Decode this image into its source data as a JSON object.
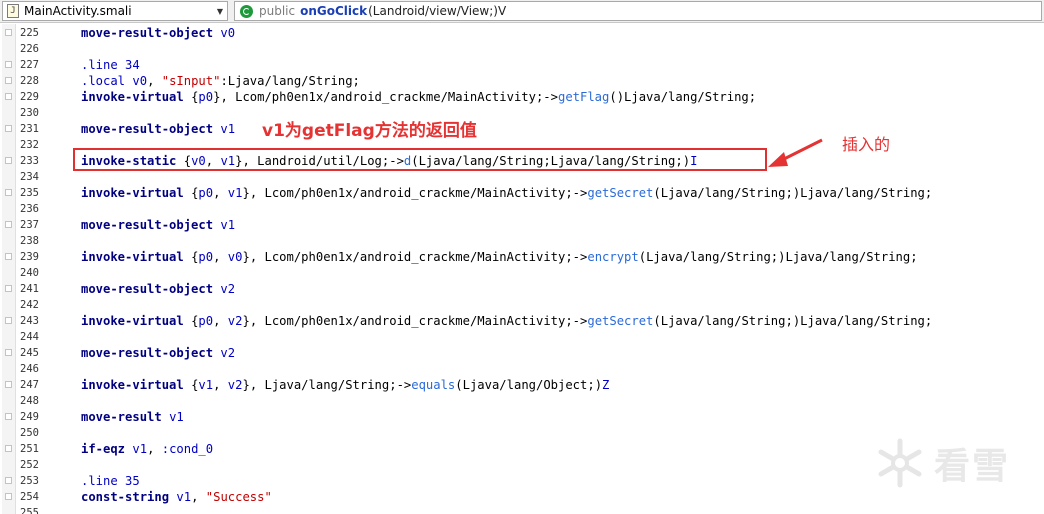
{
  "toolbar": {
    "file_icon_glyph": "J",
    "file_name": "MainActivity.smali",
    "method_modifier": "public",
    "method_name": "onGoClick",
    "method_signature": "(Landroid/view/View;)V"
  },
  "annotations": {
    "v1_note": "v1为getFlag方法的返回值",
    "insert_note": "插入的",
    "accent_color": "#e53333"
  },
  "watermark": {
    "text": "看雪"
  },
  "code_lines": [
    {
      "n": "225",
      "tokens": [
        [
          "k",
          "move-result-object"
        ],
        [
          "t",
          " "
        ],
        [
          "r",
          "v0"
        ]
      ]
    },
    {
      "n": "226",
      "tokens": []
    },
    {
      "n": "227",
      "tokens": [
        [
          "r",
          ".line"
        ],
        [
          "t",
          " "
        ],
        [
          "r",
          "34"
        ]
      ]
    },
    {
      "n": "228",
      "tokens": [
        [
          "r",
          ".local"
        ],
        [
          "t",
          " "
        ],
        [
          "r",
          "v0"
        ],
        [
          "t",
          ", "
        ],
        [
          "s",
          "\"sInput\""
        ],
        [
          "t",
          ":Ljava/lang/String;"
        ]
      ]
    },
    {
      "n": "229",
      "tokens": [
        [
          "k",
          "invoke-virtual"
        ],
        [
          "t",
          " {"
        ],
        [
          "r",
          "p0"
        ],
        [
          "t",
          "}, Lcom/ph0en1x/android_crackme/MainActivity;->"
        ],
        [
          "m",
          "getFlag"
        ],
        [
          "t",
          "()Ljava/lang/String;"
        ]
      ]
    },
    {
      "n": "230",
      "tokens": []
    },
    {
      "n": "231",
      "tokens": [
        [
          "k",
          "move-result-object"
        ],
        [
          "t",
          " "
        ],
        [
          "r",
          "v1"
        ]
      ]
    },
    {
      "n": "232",
      "tokens": []
    },
    {
      "n": "233",
      "tokens": [
        [
          "k",
          "invoke-static"
        ],
        [
          "t",
          " {"
        ],
        [
          "r",
          "v0"
        ],
        [
          "t",
          ", "
        ],
        [
          "r",
          "v1"
        ],
        [
          "t",
          "}, Landroid/util/Log;->"
        ],
        [
          "m",
          "d"
        ],
        [
          "t",
          "(Ljava/lang/String;Ljava/lang/String;)"
        ],
        [
          "r",
          "I"
        ]
      ]
    },
    {
      "n": "234",
      "tokens": []
    },
    {
      "n": "235",
      "tokens": [
        [
          "k",
          "invoke-virtual"
        ],
        [
          "t",
          " {"
        ],
        [
          "r",
          "p0"
        ],
        [
          "t",
          ", "
        ],
        [
          "r",
          "v1"
        ],
        [
          "t",
          "}, Lcom/ph0en1x/android_crackme/MainActivity;->"
        ],
        [
          "m",
          "getSecret"
        ],
        [
          "t",
          "(Ljava/lang/String;)Ljava/lang/String;"
        ]
      ]
    },
    {
      "n": "236",
      "tokens": []
    },
    {
      "n": "237",
      "tokens": [
        [
          "k",
          "move-result-object"
        ],
        [
          "t",
          " "
        ],
        [
          "r",
          "v1"
        ]
      ]
    },
    {
      "n": "238",
      "tokens": []
    },
    {
      "n": "239",
      "tokens": [
        [
          "k",
          "invoke-virtual"
        ],
        [
          "t",
          " {"
        ],
        [
          "r",
          "p0"
        ],
        [
          "t",
          ", "
        ],
        [
          "r",
          "v0"
        ],
        [
          "t",
          "}, Lcom/ph0en1x/android_crackme/MainActivity;->"
        ],
        [
          "m",
          "encrypt"
        ],
        [
          "t",
          "(Ljava/lang/String;)Ljava/lang/String;"
        ]
      ]
    },
    {
      "n": "240",
      "tokens": []
    },
    {
      "n": "241",
      "tokens": [
        [
          "k",
          "move-result-object"
        ],
        [
          "t",
          " "
        ],
        [
          "r",
          "v2"
        ]
      ]
    },
    {
      "n": "242",
      "tokens": []
    },
    {
      "n": "243",
      "tokens": [
        [
          "k",
          "invoke-virtual"
        ],
        [
          "t",
          " {"
        ],
        [
          "r",
          "p0"
        ],
        [
          "t",
          ", "
        ],
        [
          "r",
          "v2"
        ],
        [
          "t",
          "}, Lcom/ph0en1x/android_crackme/MainActivity;->"
        ],
        [
          "m",
          "getSecret"
        ],
        [
          "t",
          "(Ljava/lang/String;)Ljava/lang/String;"
        ]
      ]
    },
    {
      "n": "244",
      "tokens": []
    },
    {
      "n": "245",
      "tokens": [
        [
          "k",
          "move-result-object"
        ],
        [
          "t",
          " "
        ],
        [
          "r",
          "v2"
        ]
      ]
    },
    {
      "n": "246",
      "tokens": []
    },
    {
      "n": "247",
      "tokens": [
        [
          "k",
          "invoke-virtual"
        ],
        [
          "t",
          " {"
        ],
        [
          "r",
          "v1"
        ],
        [
          "t",
          ", "
        ],
        [
          "r",
          "v2"
        ],
        [
          "t",
          "}, Ljava/lang/String;->"
        ],
        [
          "m",
          "equals"
        ],
        [
          "t",
          "(Ljava/lang/Object;)"
        ],
        [
          "r",
          "Z"
        ]
      ]
    },
    {
      "n": "248",
      "tokens": []
    },
    {
      "n": "249",
      "tokens": [
        [
          "k",
          "move-result"
        ],
        [
          "t",
          " "
        ],
        [
          "r",
          "v1"
        ]
      ]
    },
    {
      "n": "250",
      "tokens": []
    },
    {
      "n": "251",
      "tokens": [
        [
          "k",
          "if-eqz"
        ],
        [
          "t",
          " "
        ],
        [
          "r",
          "v1"
        ],
        [
          "t",
          ", "
        ],
        [
          "r",
          ":cond_0"
        ]
      ]
    },
    {
      "n": "252",
      "tokens": []
    },
    {
      "n": "253",
      "tokens": [
        [
          "r",
          ".line"
        ],
        [
          "t",
          " "
        ],
        [
          "r",
          "35"
        ]
      ]
    },
    {
      "n": "254",
      "tokens": [
        [
          "k",
          "const-string"
        ],
        [
          "t",
          " "
        ],
        [
          "r",
          "v1"
        ],
        [
          "t",
          ", "
        ],
        [
          "s",
          "\"Success\""
        ]
      ]
    },
    {
      "n": "255",
      "tokens": []
    }
  ]
}
